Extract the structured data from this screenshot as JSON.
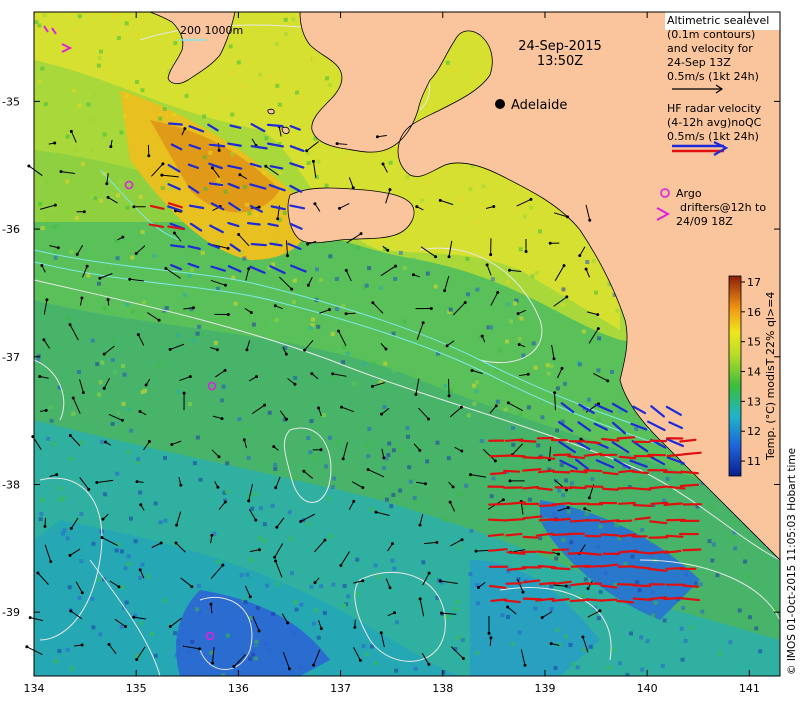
{
  "map": {
    "title_date": "24-Sep-2015",
    "title_time": "13:50Z",
    "city": "Adelaide",
    "depth_contours_label": "200 1000m",
    "credit": "© IMOS 01-Oct-2015 11:05:03 Hobart time",
    "lon_ticks": [
      "134",
      "135",
      "136",
      "137",
      "138",
      "139",
      "140",
      "141"
    ],
    "lat_ticks": [
      "-35",
      "-36",
      "-37",
      "-38",
      "-39"
    ]
  },
  "legend": {
    "altimetry_lines": [
      "Altimetric sealevel",
      "(0.1m contours)",
      "and velocity for",
      "24-Sep 13Z",
      "0.5m/s (1kt 24h)"
    ],
    "hf_radar_lines": [
      "HF radar velocity",
      "(4-12h avg)noQC",
      "0.5m/s (1kt 24h)"
    ],
    "argo_label": "Argo",
    "drifter_lines": [
      "drifters@12h to",
      "24/09 18Z"
    ]
  },
  "colorbar": {
    "label": "Temp. (°C) modisT 22% ql>=4",
    "ticks": [
      "11",
      "12",
      "13",
      "14",
      "15",
      "16",
      "17"
    ],
    "min": 10.5,
    "max": 17.2
  },
  "colors": {
    "land": "#fac59c",
    "argo": "#e020e0",
    "hf_radar_a": "#1e2ad8",
    "hf_radar_b": "#e01010",
    "contour": "#e8e8e8"
  }
}
